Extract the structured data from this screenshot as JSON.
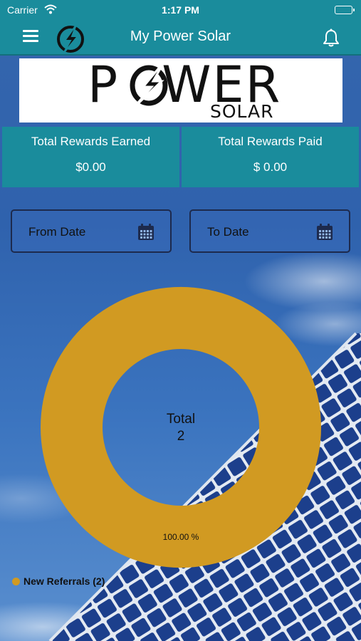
{
  "status_bar": {
    "carrier": "Carrier",
    "time": "1:17 PM"
  },
  "nav": {
    "title": "My Power Solar",
    "menu_icon": "hamburger-menu-icon",
    "logo_icon": "lightning-bolt-circle-icon",
    "bell_icon": "bell-icon"
  },
  "brand": {
    "word_left": "P",
    "word_right": "WER",
    "sub": "SOLAR"
  },
  "rewards": {
    "earned_label": "Total Rewards Earned",
    "earned_value": "$0.00",
    "paid_label": "Total Rewards Paid",
    "paid_value": "$ 0.00"
  },
  "filters": {
    "from_placeholder": "From Date",
    "to_placeholder": "To Date",
    "calendar_icon": "calendar-icon"
  },
  "colors": {
    "teal": "#1a8c9c",
    "donut": "#d19a22"
  },
  "chart_data": {
    "type": "pie",
    "donut": true,
    "center_label_line1": "Total",
    "center_label_line2": "2",
    "slices": [
      {
        "name": "New Referrals",
        "value": 2,
        "percent_label": "100.00 %"
      }
    ],
    "legend": [
      {
        "label": "New Referrals (2)",
        "color": "#d19a22"
      }
    ],
    "legend_position": "bottom-left"
  }
}
